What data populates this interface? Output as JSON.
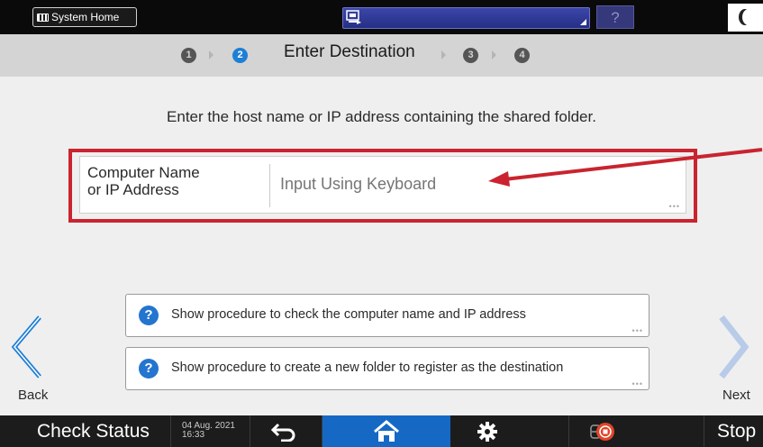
{
  "topbar": {
    "system_home_label": "System Home",
    "help_label": "?"
  },
  "steps": {
    "items": [
      "1",
      "2",
      "3",
      "4"
    ],
    "active": 2,
    "title": "Enter Destination"
  },
  "main": {
    "instruction": "Enter the host name or IP address containing the shared folder.",
    "field": {
      "label_line1": "Computer Name",
      "label_line2": "or IP Address",
      "placeholder": "Input Using Keyboard",
      "value": ""
    },
    "procedures": [
      {
        "label": "Show procedure to check the computer name and IP address"
      },
      {
        "label": "Show procedure to create a new folder to register as the destination"
      }
    ],
    "back_label": "Back",
    "next_label": "Next",
    "dots": "•••"
  },
  "bottombar": {
    "check_status_label": "Check Status",
    "date": "04 Aug. 2021",
    "time": "16:33",
    "stop_label": "Stop"
  },
  "colors": {
    "accent": "#1e7fd6",
    "highlight": "#c9242f",
    "home": "#1569c4"
  },
  "icons": {
    "system_home": "grid-icon",
    "app_selector": "device-icon",
    "help": "help-icon",
    "mode": "moon-icon",
    "back_nav": "chevron-left-icon",
    "next_nav": "chevron-right-icon",
    "info": "question-circle-icon",
    "back_bottom": "return-arrow-icon",
    "home": "home-icon",
    "settings": "gear-icon",
    "memory": "memory-icon",
    "stop": "stop-icon"
  }
}
